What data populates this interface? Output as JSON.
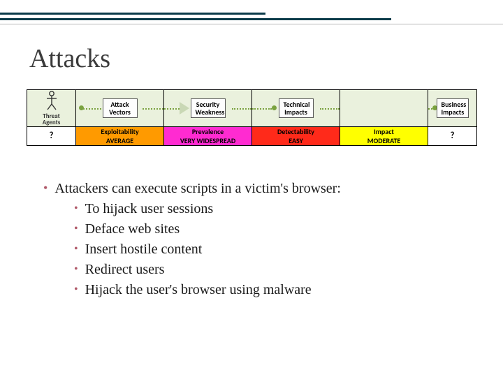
{
  "title": "Attacks",
  "diagram": {
    "headers": {
      "threat_label_top": "Threat",
      "threat_label_bot": "Agents",
      "attack_vectors": "Attack\nVectors",
      "security_weakness": "Security\nWeakness",
      "technical_impacts": "Technical\nImpacts",
      "business_impacts": "Business\nImpacts"
    },
    "row2": {
      "col0": "?",
      "col1_top": "Exploitability",
      "col1_bot": "AVERAGE",
      "col2_top": "Prevalence",
      "col2_bot": "VERY WIDESPREAD",
      "col3_top": "Detectability",
      "col3_bot": "EASY",
      "col4_top": "Impact",
      "col4_bot": "MODERATE",
      "col5": "?"
    }
  },
  "bullets": {
    "main": "Attackers can execute scripts in a victim's browser:",
    "subs": [
      "To hijack user sessions",
      "Deface web sites",
      "Insert hostile content",
      "Redirect users",
      "Hijack the user's browser using malware"
    ]
  }
}
